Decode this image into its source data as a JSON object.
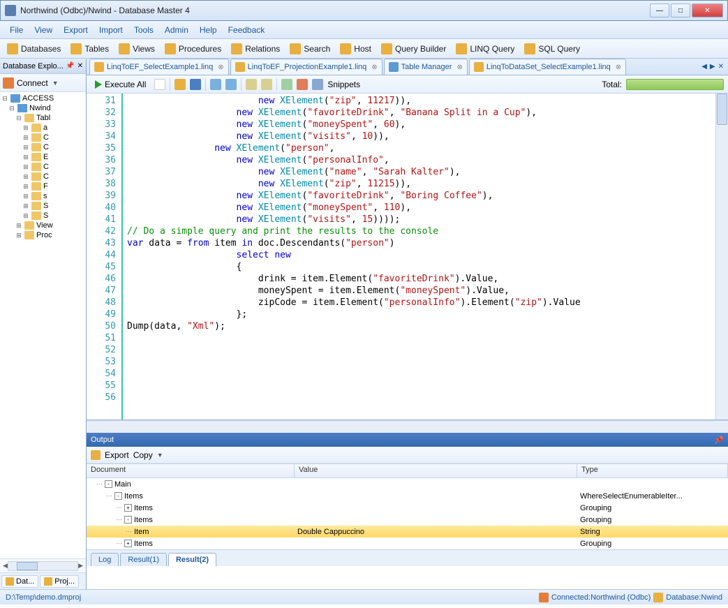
{
  "titlebar": {
    "text": "Northwind (Odbc)/Nwind - Database Master 4"
  },
  "menubar": [
    "File",
    "View",
    "Export",
    "Import",
    "Tools",
    "Admin",
    "Help",
    "Feedback"
  ],
  "toolbar": [
    {
      "icon": "dbs",
      "label": "Databases"
    },
    {
      "icon": "tbl",
      "label": "Tables"
    },
    {
      "icon": "vw",
      "label": "Views"
    },
    {
      "icon": "prc",
      "label": "Procedures"
    },
    {
      "icon": "rel",
      "label": "Relations"
    },
    {
      "icon": "srch",
      "label": "Search"
    },
    {
      "icon": "host",
      "label": "Host"
    },
    {
      "icon": "qb",
      "label": "Query Builder"
    },
    {
      "icon": "linq",
      "label": "LINQ Query"
    },
    {
      "icon": "sql",
      "label": "SQL Query"
    }
  ],
  "leftPanel": {
    "title": "Database Explo...",
    "connect": "Connect",
    "tree": [
      {
        "indent": 0,
        "toggle": "-",
        "icon": "db",
        "label": "ACCESS"
      },
      {
        "indent": 1,
        "toggle": "-",
        "icon": "db",
        "label": "Nwind"
      },
      {
        "indent": 2,
        "toggle": "-",
        "icon": "folder",
        "label": "Tabl"
      },
      {
        "indent": 3,
        "toggle": "+",
        "icon": "folder",
        "label": "a"
      },
      {
        "indent": 3,
        "toggle": "+",
        "icon": "folder",
        "label": "C"
      },
      {
        "indent": 3,
        "toggle": "+",
        "icon": "folder",
        "label": "C"
      },
      {
        "indent": 3,
        "toggle": "+",
        "icon": "folder",
        "label": "E"
      },
      {
        "indent": 3,
        "toggle": "+",
        "icon": "folder",
        "label": "C"
      },
      {
        "indent": 3,
        "toggle": "+",
        "icon": "folder",
        "label": "C"
      },
      {
        "indent": 3,
        "toggle": "+",
        "icon": "folder",
        "label": "F"
      },
      {
        "indent": 3,
        "toggle": "+",
        "icon": "folder",
        "label": "s"
      },
      {
        "indent": 3,
        "toggle": "+",
        "icon": "folder",
        "label": "S"
      },
      {
        "indent": 3,
        "toggle": "+",
        "icon": "folder",
        "label": "S"
      },
      {
        "indent": 2,
        "toggle": "+",
        "icon": "folder",
        "label": "View"
      },
      {
        "indent": 2,
        "toggle": "+",
        "icon": "folder",
        "label": "Proc"
      }
    ],
    "tabs": [
      "Dat...",
      "Proj..."
    ]
  },
  "docTabs": [
    {
      "icon": "linq",
      "label": "LinqToEF_SelectExample1.linq",
      "close": true
    },
    {
      "icon": "linq",
      "label": "LinqToEF_ProjectionExample1.linq",
      "close": true
    },
    {
      "icon": "tm",
      "label": "Table Manager",
      "close": true
    },
    {
      "icon": "linq",
      "label": "LinqToDataSet_SelectExample1.linq",
      "close": true
    }
  ],
  "edToolbar": {
    "execute": "Execute All",
    "snippets": "Snippets",
    "total": "Total:"
  },
  "code": {
    "startLine": 31,
    "lines": [
      [
        [
          "                        "
        ],
        [
          "kw",
          "new"
        ],
        [
          " "
        ],
        [
          "type",
          "XElement"
        ],
        [
          "("
        ],
        [
          "str",
          "\"zip\""
        ],
        [
          ", "
        ],
        [
          "num",
          "11217"
        ],
        [
          ")),"
        ]
      ],
      [
        [
          "                    "
        ],
        [
          "kw",
          "new"
        ],
        [
          " "
        ],
        [
          "type",
          "XElement"
        ],
        [
          "("
        ],
        [
          "str",
          "\"favoriteDrink\""
        ],
        [
          ", "
        ],
        [
          "str",
          "\"Banana Split in a Cup\""
        ],
        [
          "),"
        ]
      ],
      [
        [
          "                    "
        ],
        [
          "kw",
          "new"
        ],
        [
          " "
        ],
        [
          "type",
          "XElement"
        ],
        [
          "("
        ],
        [
          "str",
          "\"moneySpent\""
        ],
        [
          ", "
        ],
        [
          "num",
          "60"
        ],
        [
          "),"
        ]
      ],
      [
        [
          "                    "
        ],
        [
          "kw",
          "new"
        ],
        [
          " "
        ],
        [
          "type",
          "XElement"
        ],
        [
          "("
        ],
        [
          "str",
          "\"visits\""
        ],
        [
          ", "
        ],
        [
          "num",
          "10"
        ],
        [
          ")),"
        ]
      ],
      [
        [
          "                "
        ],
        [
          "kw",
          "new"
        ],
        [
          " "
        ],
        [
          "type",
          "XElement"
        ],
        [
          "("
        ],
        [
          "str",
          "\"person\""
        ],
        [
          ","
        ]
      ],
      [
        [
          "                    "
        ],
        [
          "kw",
          "new"
        ],
        [
          " "
        ],
        [
          "type",
          "XElement"
        ],
        [
          "("
        ],
        [
          "str",
          "\"personalInfo\""
        ],
        [
          ","
        ]
      ],
      [
        [
          "                        "
        ],
        [
          "kw",
          "new"
        ],
        [
          " "
        ],
        [
          "type",
          "XElement"
        ],
        [
          "("
        ],
        [
          "str",
          "\"name\""
        ],
        [
          ", "
        ],
        [
          "str",
          "\"Sarah Kalter\""
        ],
        [
          "),"
        ]
      ],
      [
        [
          "                        "
        ],
        [
          "kw",
          "new"
        ],
        [
          " "
        ],
        [
          "type",
          "XElement"
        ],
        [
          "("
        ],
        [
          "str",
          "\"zip\""
        ],
        [
          ", "
        ],
        [
          "num",
          "11215"
        ],
        [
          ")),"
        ]
      ],
      [
        [
          "                    "
        ],
        [
          "kw",
          "new"
        ],
        [
          " "
        ],
        [
          "type",
          "XElement"
        ],
        [
          "("
        ],
        [
          "str",
          "\"favoriteDrink\""
        ],
        [
          ", "
        ],
        [
          "str",
          "\"Boring Coffee\""
        ],
        [
          "),"
        ]
      ],
      [
        [
          "                    "
        ],
        [
          "kw",
          "new"
        ],
        [
          " "
        ],
        [
          "type",
          "XElement"
        ],
        [
          "("
        ],
        [
          "str",
          "\"moneySpent\""
        ],
        [
          ", "
        ],
        [
          "num",
          "110"
        ],
        [
          "),"
        ]
      ],
      [
        [
          "                    "
        ],
        [
          "kw",
          "new"
        ],
        [
          " "
        ],
        [
          "type",
          "XElement"
        ],
        [
          "("
        ],
        [
          "str",
          "\"visits\""
        ],
        [
          ", "
        ],
        [
          "num",
          "15"
        ],
        [
          "))));"
        ]
      ],
      [
        [
          ""
        ]
      ],
      [
        [
          "cmt",
          "// Do a simple query and print the results to the console"
        ]
      ],
      [
        [
          "kw",
          "var"
        ],
        [
          " data = "
        ],
        [
          "kw",
          "from"
        ],
        [
          " item "
        ],
        [
          "kw",
          "in"
        ],
        [
          " doc.Descendants("
        ],
        [
          "str",
          "\"person\""
        ],
        [
          ")"
        ]
      ],
      [
        [
          "                    "
        ],
        [
          "kw",
          "select"
        ],
        [
          " "
        ],
        [
          "kw",
          "new"
        ]
      ],
      [
        [
          "                    {"
        ]
      ],
      [
        [
          "                        drink = item.Element("
        ],
        [
          "str",
          "\"favoriteDrink\""
        ],
        [
          ").Value,"
        ]
      ],
      [
        [
          "                        moneySpent = item.Element("
        ],
        [
          "str",
          "\"moneySpent\""
        ],
        [
          ").Value,"
        ]
      ],
      [
        [
          "                        zipCode = item.Element("
        ],
        [
          "str",
          "\"personalInfo\""
        ],
        [
          ").Element("
        ],
        [
          "str",
          "\"zip\""
        ],
        [
          ").Value"
        ]
      ],
      [
        [
          "                    };"
        ]
      ],
      [
        [
          ""
        ]
      ],
      [
        [
          "Dump(data, "
        ],
        [
          "str",
          "\"Xml\""
        ],
        [
          ");"
        ]
      ],
      [
        [
          ""
        ]
      ],
      [
        [
          ""
        ]
      ],
      [
        [
          ""
        ]
      ],
      [
        [
          ""
        ]
      ]
    ]
  },
  "output": {
    "title": "Output",
    "toolbar": {
      "export": "Export",
      "copy": "Copy"
    },
    "columns": {
      "doc": "Document",
      "val": "Value",
      "type": "Type"
    },
    "rows": [
      {
        "indent": 14,
        "toggle": "-",
        "label": "Main",
        "value": "",
        "type": ""
      },
      {
        "indent": 28,
        "toggle": "-",
        "label": "Items",
        "value": "",
        "type": "WhereSelectEnumerableIter..."
      },
      {
        "indent": 42,
        "toggle": "+",
        "label": "Items",
        "value": "",
        "type": "Grouping"
      },
      {
        "indent": 42,
        "toggle": "-",
        "label": "Items",
        "value": "",
        "type": "Grouping"
      },
      {
        "indent": 56,
        "toggle": "",
        "label": "Item",
        "value": "Double Cappuccino",
        "type": "String",
        "sel": true
      },
      {
        "indent": 42,
        "toggle": "+",
        "label": "Items",
        "value": "",
        "type": "Grouping"
      }
    ],
    "tabs": [
      {
        "label": "Log",
        "active": false
      },
      {
        "label": "Result(1)",
        "active": false
      },
      {
        "label": "Result(2)",
        "active": true
      }
    ]
  },
  "statusbar": {
    "left": "D:\\Temp\\demo.dmproj",
    "conn": "Connected:Northwind (Odbc)",
    "db": "Database:Nwind"
  }
}
